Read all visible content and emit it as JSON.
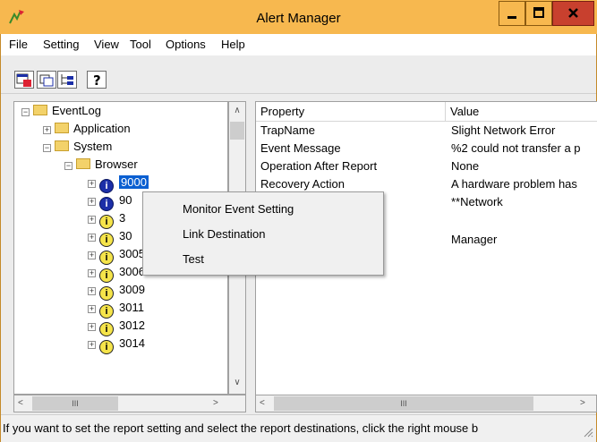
{
  "window": {
    "title": "Alert Manager"
  },
  "menu": [
    "File",
    "Setting",
    "View",
    "Tool",
    "Options",
    "Help"
  ],
  "toolbar": {
    "buttons": [
      {
        "name": "event-setting-button-icon",
        "glyph": "⊞B"
      },
      {
        "name": "destination-button-icon",
        "glyph": "⧉"
      },
      {
        "name": "tree-view-button-icon",
        "glyph": "⊢"
      },
      {
        "name": "help-button-icon",
        "glyph": "?"
      }
    ]
  },
  "tree": {
    "root": "EventLog",
    "children": [
      "Application",
      "System"
    ],
    "browser": "Browser",
    "events": [
      {
        "id": "9000",
        "icon": "blue",
        "selected": true
      },
      {
        "id": "90",
        "icon": "blue"
      },
      {
        "id": "3",
        "icon": "yellow"
      },
      {
        "id": "30",
        "icon": "yellow"
      },
      {
        "id": "3005",
        "icon": "yellow"
      },
      {
        "id": "3006",
        "icon": "yellow"
      },
      {
        "id": "3009",
        "icon": "yellow"
      },
      {
        "id": "3011",
        "icon": "yellow"
      },
      {
        "id": "3012",
        "icon": "yellow"
      },
      {
        "id": "3014",
        "icon": "yellow"
      }
    ]
  },
  "list": {
    "headers": [
      "Property",
      "Value"
    ],
    "rows": [
      {
        "property": "TrapName",
        "value": "Slight Network Error"
      },
      {
        "property": "Event Message",
        "value": "%2 could not transfer a p"
      },
      {
        "property": "Operation After Report",
        "value": "None"
      },
      {
        "property": "Recovery Action",
        "value": "A hardware problem has"
      },
      {
        "property": "",
        "value": "**Network"
      },
      {
        "property": "",
        "value": ""
      },
      {
        "property": "",
        "value": "Manager"
      }
    ]
  },
  "context_menu": {
    "items": [
      "Monitor Event Setting",
      "Link Destination",
      "Test"
    ]
  },
  "scroll": {
    "left_thumb": "III",
    "right_thumb": "III"
  },
  "status": {
    "text": "If you want to set the report setting and select the report destinations, click the right mouse b"
  }
}
